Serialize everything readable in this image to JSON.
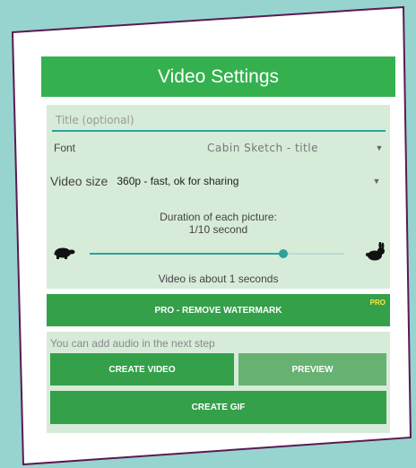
{
  "header": {
    "title": "Video Settings"
  },
  "form": {
    "title_placeholder": "Title (optional)",
    "font_label": "Font",
    "font_value": "Cabin Sketch - title",
    "video_size_label": "Video size",
    "video_size_value": "360p - fast, ok for sharing"
  },
  "duration": {
    "title": "Duration of each picture:",
    "value": "1/10 second",
    "slider_fraction": 0.76,
    "estimate": "Video is about 1 seconds"
  },
  "buttons": {
    "pro_label": "PRO - REMOVE WATERMARK",
    "pro_badge": "PRO",
    "create_video": "CREATE VIDEO",
    "preview": "PREVIEW",
    "create_gif": "CREATE GIF"
  },
  "audio": {
    "hint": "You can add audio in the next step"
  },
  "colors": {
    "accent": "#34b14e",
    "panel": "#d6ebd8",
    "teal": "#2ea29a",
    "background": "#97d4d0"
  },
  "icons": {
    "slow": "turtle-icon",
    "fast": "rabbit-icon"
  }
}
